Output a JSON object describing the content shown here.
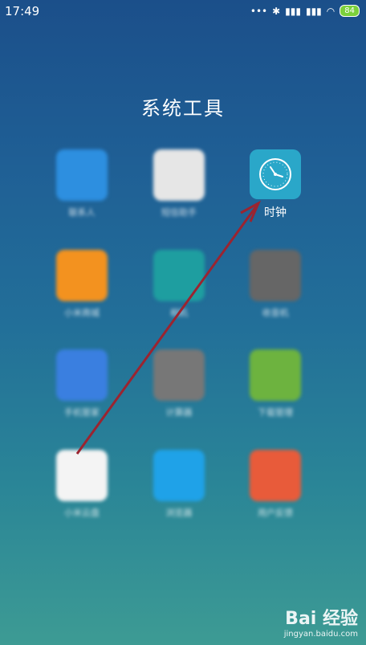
{
  "status_bar": {
    "time": "17:49",
    "signal_text": "•••",
    "battery": "84"
  },
  "folder": {
    "title": "系统工具"
  },
  "apps": [
    {
      "name": "contacts",
      "label": "联系人",
      "color": "#2d8fe0"
    },
    {
      "name": "messages",
      "label": "短信助手",
      "color": "#e8e8e8"
    },
    {
      "name": "clock",
      "label": "时钟",
      "color": "#2aa7c9"
    },
    {
      "name": "mi-store",
      "label": "小米商城",
      "color": "#f3921f"
    },
    {
      "name": "camera",
      "label": "相机",
      "color": "#1e9ea0"
    },
    {
      "name": "fm",
      "label": "收音机",
      "color": "#6a6a6a"
    },
    {
      "name": "security",
      "label": "手机管家",
      "color": "#3a7fe0"
    },
    {
      "name": "calculator",
      "label": "计算器",
      "color": "#7a7a7a"
    },
    {
      "name": "downloads",
      "label": "下载管理",
      "color": "#6db33f"
    },
    {
      "name": "mi-drive",
      "label": "小米云盘",
      "color": "#f4f4f4"
    },
    {
      "name": "browser",
      "label": "浏览器",
      "color": "#1fa2e8"
    },
    {
      "name": "feedback",
      "label": "用户反馈",
      "color": "#e85b3a"
    }
  ],
  "watermark": {
    "main": "Bai 经验",
    "sub": "jingyan.baidu.com"
  }
}
